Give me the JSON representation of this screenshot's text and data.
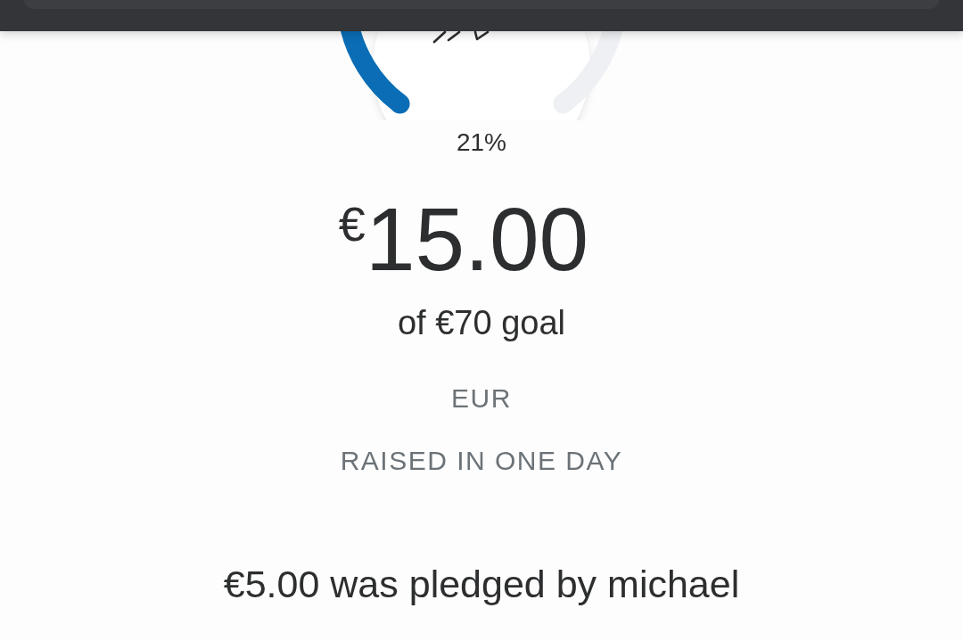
{
  "progress": {
    "level": 0.21,
    "percent": "21%"
  },
  "amount": {
    "symbol": "€",
    "value": "15.00"
  },
  "goal": "of €70 goal",
  "currency": "EUR",
  "caption": "RAISED IN ONE DAY",
  "pledge_message": "€5.00 was pledged by michael"
}
